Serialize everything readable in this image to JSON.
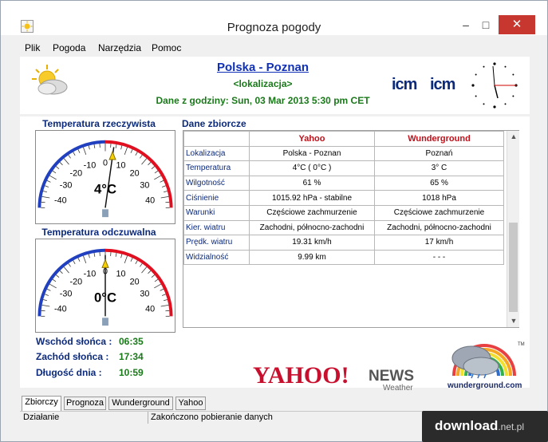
{
  "window": {
    "title": "Prognoza pogody"
  },
  "menu": {
    "items": [
      "Plik",
      "Pogoda",
      "Narzędzia",
      "Pomoc"
    ]
  },
  "header": {
    "location": "Polska - Poznan",
    "sub": "<lokalizacja>",
    "date_line": "Dane z godziny: Sun, 03 Mar 2013 5:30 pm CET"
  },
  "gauges": {
    "real": {
      "title": "Temperatura rzeczywista",
      "value": "4°C",
      "temp": 4
    },
    "feel": {
      "title": "Temperatura odczuwalna",
      "value": "0°C",
      "temp": 0
    },
    "ticks": [
      "-40",
      "-30",
      "-20",
      "-10",
      "0",
      "10",
      "20",
      "30",
      "40"
    ]
  },
  "sun": {
    "sunrise_label": "Wschód słońca :",
    "sunrise": "06:35",
    "sunset_label": "Zachód słońca :",
    "sunset": "17:34",
    "daylen_label": "Długość dnia :",
    "daylen": "10:59"
  },
  "data": {
    "title": "Dane zbiorcze",
    "headers": [
      "Yahoo",
      "Wunderground"
    ],
    "rows": [
      {
        "label": "Lokalizacja",
        "yahoo": "Polska - Poznan",
        "wu": "Poznań"
      },
      {
        "label": "Temperatura",
        "yahoo": "4°C  ( 0°C )",
        "wu": "3° C"
      },
      {
        "label": "Wilgotność",
        "yahoo": "61 %",
        "wu": "65 %"
      },
      {
        "label": "Ciśnienie",
        "yahoo": "1015.92 hPa - stabilne",
        "wu": "1018 hPa"
      },
      {
        "label": "Warunki",
        "yahoo": "Częściowe zachmurzenie",
        "wu": "Częściowe zachmurzenie"
      },
      {
        "label": "Kier. wiatru",
        "yahoo": "Zachodni, północno-zachodni",
        "wu": "Zachodni, północno-zachodni"
      },
      {
        "label": "Prędk. wiatru",
        "yahoo": "19.31 km/h",
        "wu": "17 km/h"
      },
      {
        "label": "Widzialność",
        "yahoo": "9.99 km",
        "wu": "- - -"
      }
    ]
  },
  "logos": {
    "yahoo": "YAHOO!",
    "yahoo_news": "NEWS",
    "yahoo_weather": "Weather",
    "wu": "wunderground.com",
    "icm": "icm"
  },
  "tabs": [
    "Zbiorczy",
    "Prognoza",
    "Wunderground",
    "Yahoo"
  ],
  "status": {
    "left": "Działanie",
    "right": "Zakończono pobieranie danych"
  },
  "watermark": {
    "text": "download",
    "suffix": ".net.pl"
  },
  "colors": {
    "label_blue": "#0c2a7c",
    "value_green": "#1a7a1a",
    "header_red": "#c0101a",
    "link_blue": "#1030b8"
  }
}
